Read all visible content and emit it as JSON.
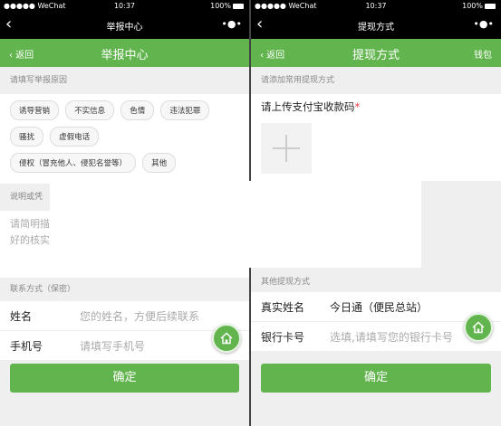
{
  "left": {
    "status": {
      "carrier": "●●●●● WeChat",
      "time": "10:37",
      "battery": "100%"
    },
    "wx_title": "举报中心",
    "nav": {
      "back": "‹  返回",
      "title": "举报中心"
    },
    "reason_label": "请填写举报原因",
    "tags": [
      "诱导营销",
      "不实信息",
      "色情",
      "违法犯罪",
      "骚扰",
      "虚假电话",
      "侵权（冒充他人、侵犯名誉等）",
      "其他"
    ],
    "desc_label": "说明或凭",
    "desc_placeholder_line1": "请简明描",
    "desc_placeholder_line2": "好的核实",
    "contact_label": "联系方式（保密）",
    "name_label": "姓名",
    "name_placeholder": "您的姓名，方便后续联系",
    "phone_label": "手机号",
    "phone_placeholder": "请填写手机号",
    "confirm": "确定"
  },
  "right": {
    "status": {
      "carrier": "●●●●● WeChat",
      "time": "10:37",
      "battery": "100%"
    },
    "wx_title": "提现方式",
    "nav": {
      "back": "‹  返回",
      "title": "提现方式",
      "right": "钱包"
    },
    "section_label": "请添加常用提现方式",
    "upload_title": "请上传支付宝收款码",
    "upload_star": "*",
    "other_label": "其他提现方式",
    "realname_label": "真实姓名",
    "realname_value": "今日通（便民总站）",
    "bank_label": "银行卡号",
    "bank_placeholder": "选填,请填写您的银行卡号",
    "confirm": "确定"
  },
  "colors": {
    "accent": "#62b54e"
  },
  "icons": {
    "float": "home-icon",
    "back": "chevron-left-icon",
    "menu": "more-dots-icon"
  }
}
